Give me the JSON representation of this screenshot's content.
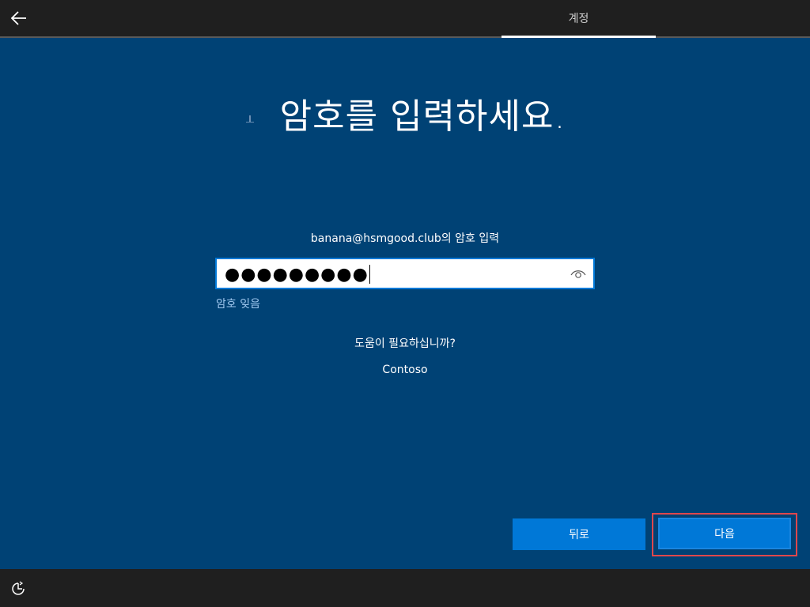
{
  "header": {
    "back_icon": "arrow-left-icon",
    "tab_label": "계정"
  },
  "main": {
    "title": "암호를 입력하세요.",
    "prompt": "banana@hsmgood.club의 암호 입력",
    "password_mask": "●●●●●●●●●",
    "forgot_link": "암호 잊음",
    "help_text": "도움이 필요하십니까?",
    "org_name": "Contoso"
  },
  "buttons": {
    "back_label": "뒤로",
    "next_label": "다음"
  },
  "footer": {
    "accessibility_icon": "accessibility-icon"
  },
  "colors": {
    "background": "#004275",
    "accent": "#0078d7",
    "link": "#9fc7ee",
    "bar": "#1f1f1f",
    "highlight": "#e0474c"
  }
}
